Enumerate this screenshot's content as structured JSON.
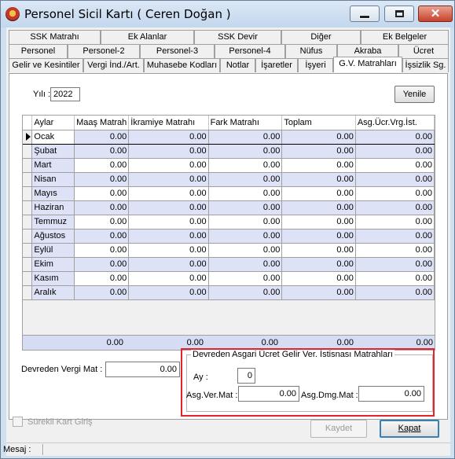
{
  "window": {
    "title": "Personel Sicil Kartı ( Ceren Doğan )"
  },
  "tabs": {
    "row1": [
      "SSK Matrahı",
      "Ek Alanlar",
      "SSK Devir",
      "Diğer",
      "Ek Belgeler"
    ],
    "row2": [
      "Personel",
      "Personel-2",
      "Personel-3",
      "Personel-4",
      "Nüfus",
      "Akraba",
      "Ücret"
    ],
    "row3": [
      "Gelir ve Kesintiler",
      "Vergi İnd./Art.",
      "Muhasebe Kodları",
      "Notlar",
      "İşaretler",
      "İşyeri",
      "G.V. Matrahları",
      "İşsizlik Sg."
    ],
    "active": "G.V. Matrahları"
  },
  "form": {
    "yil_label": "Yılı :",
    "yil_value": "2022",
    "yenile_label": "Yenile"
  },
  "grid": {
    "columns": [
      "Aylar",
      "Maaş Matrah",
      "İkramiye Matrahı",
      "Fark Matrahı",
      "Toplam",
      "Asg.Ücr.Vrg.İst."
    ],
    "rows": [
      {
        "month": "Ocak",
        "values": [
          "0.00",
          "0.00",
          "0.00",
          "0.00",
          "0.00"
        ]
      },
      {
        "month": "Şubat",
        "values": [
          "0.00",
          "0.00",
          "0.00",
          "0.00",
          "0.00"
        ]
      },
      {
        "month": "Mart",
        "values": [
          "0.00",
          "0.00",
          "0.00",
          "0.00",
          "0.00"
        ]
      },
      {
        "month": "Nisan",
        "values": [
          "0.00",
          "0.00",
          "0.00",
          "0.00",
          "0.00"
        ]
      },
      {
        "month": "Mayıs",
        "values": [
          "0.00",
          "0.00",
          "0.00",
          "0.00",
          "0.00"
        ]
      },
      {
        "month": "Haziran",
        "values": [
          "0.00",
          "0.00",
          "0.00",
          "0.00",
          "0.00"
        ]
      },
      {
        "month": "Temmuz",
        "values": [
          "0.00",
          "0.00",
          "0.00",
          "0.00",
          "0.00"
        ]
      },
      {
        "month": "Ağustos",
        "values": [
          "0.00",
          "0.00",
          "0.00",
          "0.00",
          "0.00"
        ]
      },
      {
        "month": "Eylül",
        "values": [
          "0.00",
          "0.00",
          "0.00",
          "0.00",
          "0.00"
        ]
      },
      {
        "month": "Ekim",
        "values": [
          "0.00",
          "0.00",
          "0.00",
          "0.00",
          "0.00"
        ]
      },
      {
        "month": "Kasım",
        "values": [
          "0.00",
          "0.00",
          "0.00",
          "0.00",
          "0.00"
        ]
      },
      {
        "month": "Aralık",
        "values": [
          "0.00",
          "0.00",
          "0.00",
          "0.00",
          "0.00"
        ]
      }
    ],
    "totals": [
      "0.00",
      "0.00",
      "0.00",
      "0.00",
      "0.00"
    ]
  },
  "devreden": {
    "label": "Devreden Vergi Mat :",
    "value": "0.00"
  },
  "istisna_group": {
    "title": "Devreden Asgari Ücret Gelir Ver. İstisnası Matrahları",
    "ay_label": "Ay :",
    "ay_value": "0",
    "asg_ver_label": "Asg.Ver.Mat :",
    "asg_ver_value": "0.00",
    "asg_dmg_label": "Asg.Dmg.Mat :",
    "asg_dmg_value": "0.00"
  },
  "footer": {
    "surekli_label": "Sürekli Kart Giriş",
    "kaydet_label": "Kaydet",
    "kapat_label": "Kapat",
    "mesaj_label": "Mesaj :"
  },
  "icons": [
    "app-icon",
    "minimize-icon",
    "maximize-icon",
    "close-icon",
    "row-pointer-icon"
  ],
  "colors": {
    "highlight_frame": "#e2232a",
    "row_tint": "#dde2f6"
  }
}
